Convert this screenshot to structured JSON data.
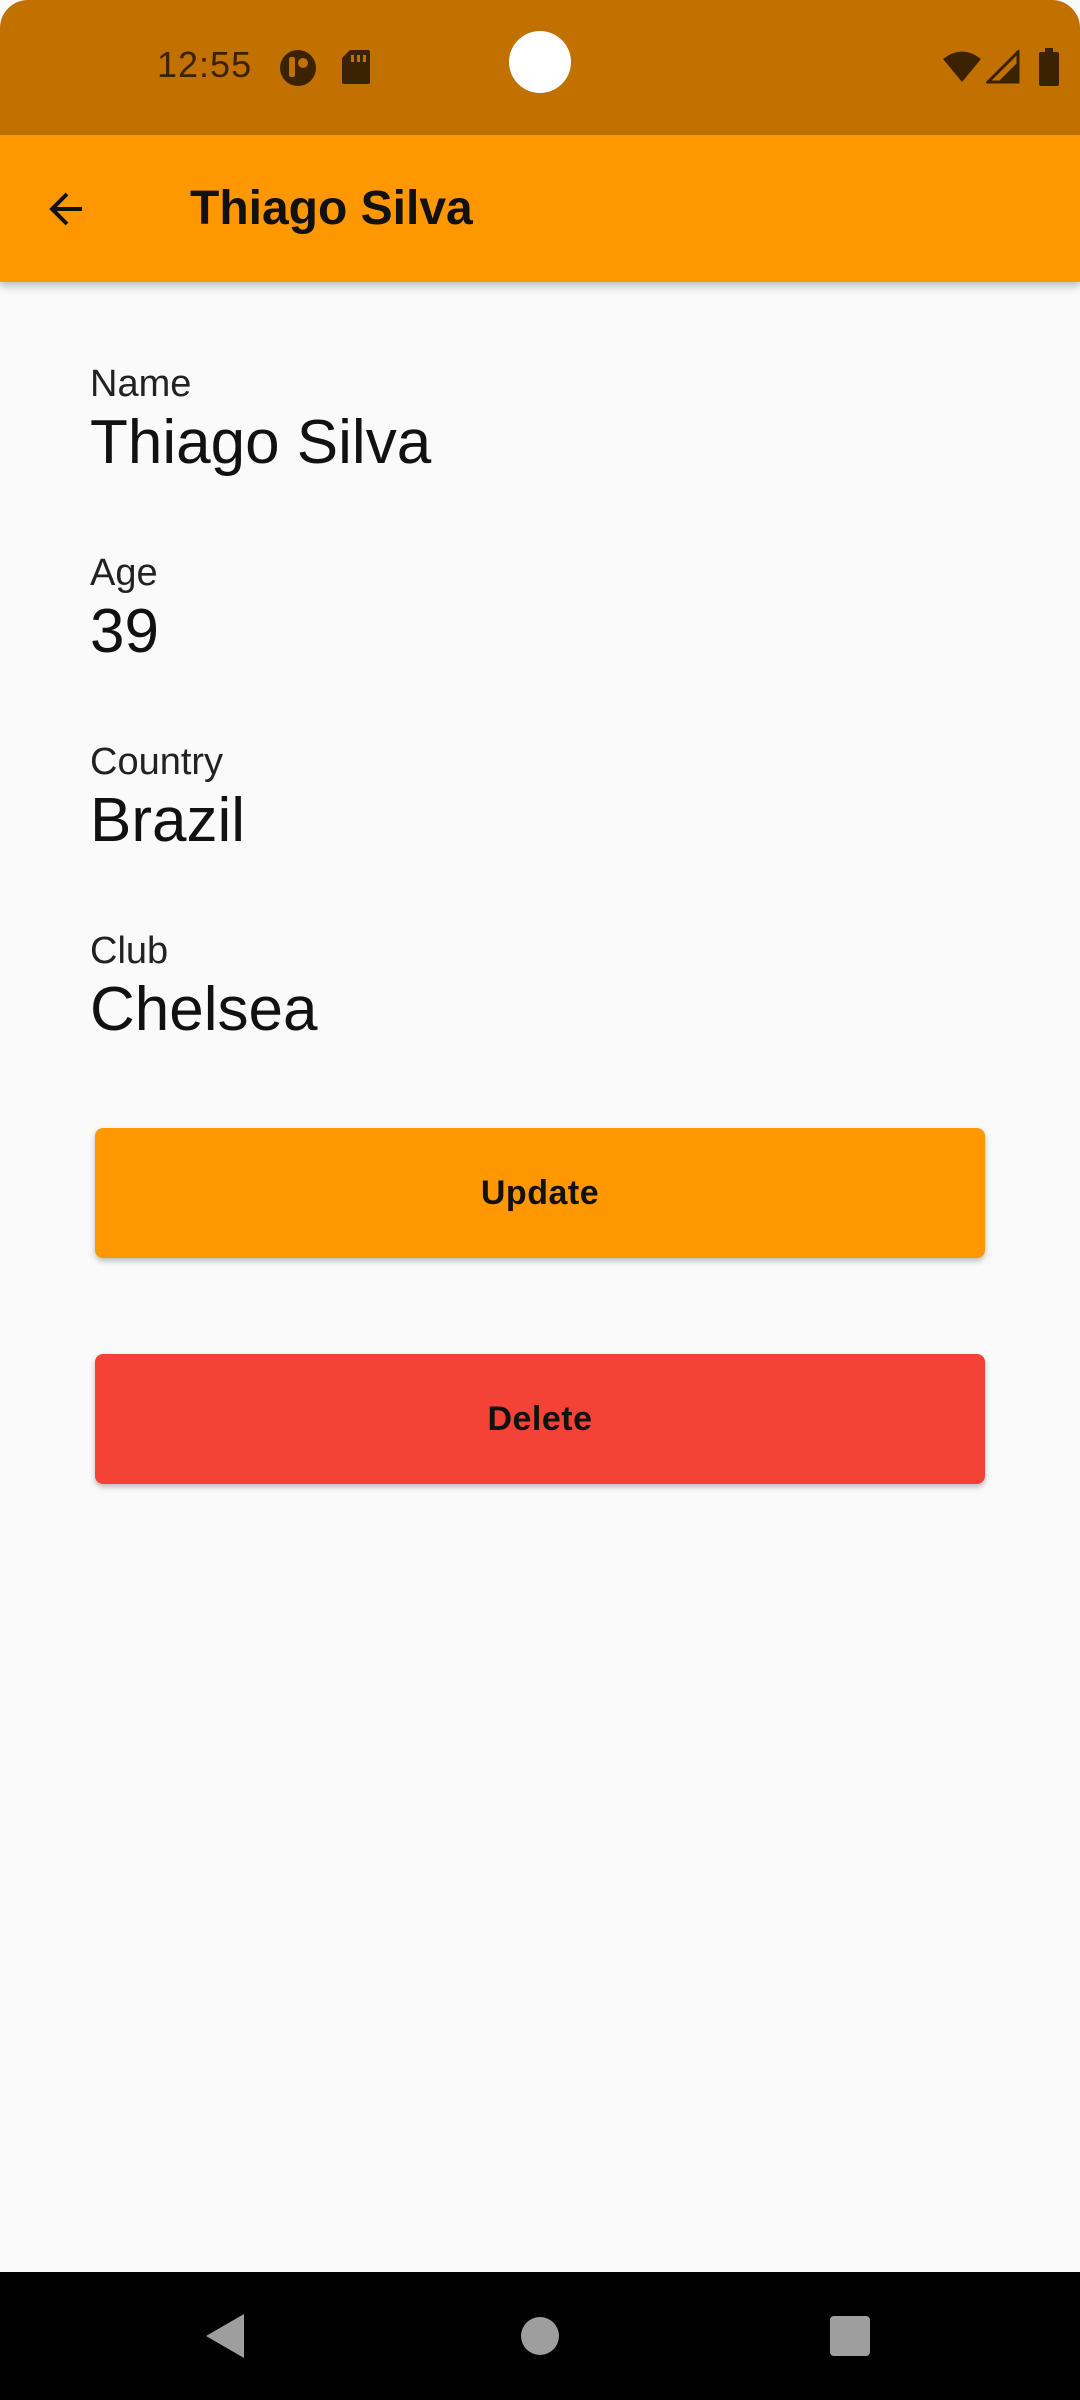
{
  "status_bar": {
    "time": "12:55",
    "icons": [
      "notification-app-icon",
      "sd-card-icon",
      "wifi-icon",
      "cell-signal-icon",
      "battery-icon"
    ]
  },
  "app_bar": {
    "back_icon": "arrow-back-icon",
    "title": "Thiago Silva",
    "color": "#ff9800"
  },
  "fields": [
    {
      "label": "Name",
      "value": "Thiago Silva"
    },
    {
      "label": "Age",
      "value": "39"
    },
    {
      "label": "Country",
      "value": "Brazil"
    },
    {
      "label": "Club",
      "value": "Chelsea"
    }
  ],
  "buttons": {
    "update_label": "Update",
    "update_color": "#ff9800",
    "delete_label": "Delete",
    "delete_color": "#f44336"
  },
  "nav_bar": {
    "icons": [
      "nav-back-icon",
      "nav-home-icon",
      "nav-recents-icon"
    ]
  }
}
